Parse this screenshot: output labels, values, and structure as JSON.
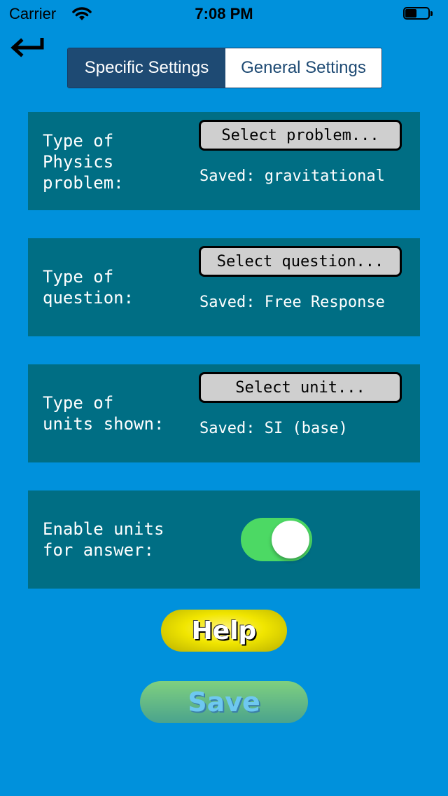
{
  "status_bar": {
    "carrier": "Carrier",
    "time": "7:08 PM"
  },
  "nav": {
    "back_icon": "return-arrow-icon"
  },
  "tabs": [
    {
      "label": "Specific Settings",
      "selected": true
    },
    {
      "label": "General Settings",
      "selected": false
    }
  ],
  "settings": {
    "problem": {
      "label_lines": [
        "Type of",
        "Physics",
        "problem:"
      ],
      "button": "Select problem...",
      "saved": "Saved: gravitational"
    },
    "question": {
      "label_lines": [
        "Type of",
        "question:"
      ],
      "button": "Select question...",
      "saved": "Saved: Free Response"
    },
    "units": {
      "label_lines": [
        "Type of",
        "units shown:"
      ],
      "button": "Select unit...",
      "saved": "Saved: SI (base)"
    },
    "enable_units": {
      "label_lines": [
        "Enable units",
        "for answer:"
      ],
      "on": true
    }
  },
  "actions": {
    "help": "Help",
    "save": "Save"
  },
  "colors": {
    "background": "#0091dc",
    "card": "#006e84",
    "toggle_on": "#4cd964",
    "tab_active": "#1e4a73"
  }
}
